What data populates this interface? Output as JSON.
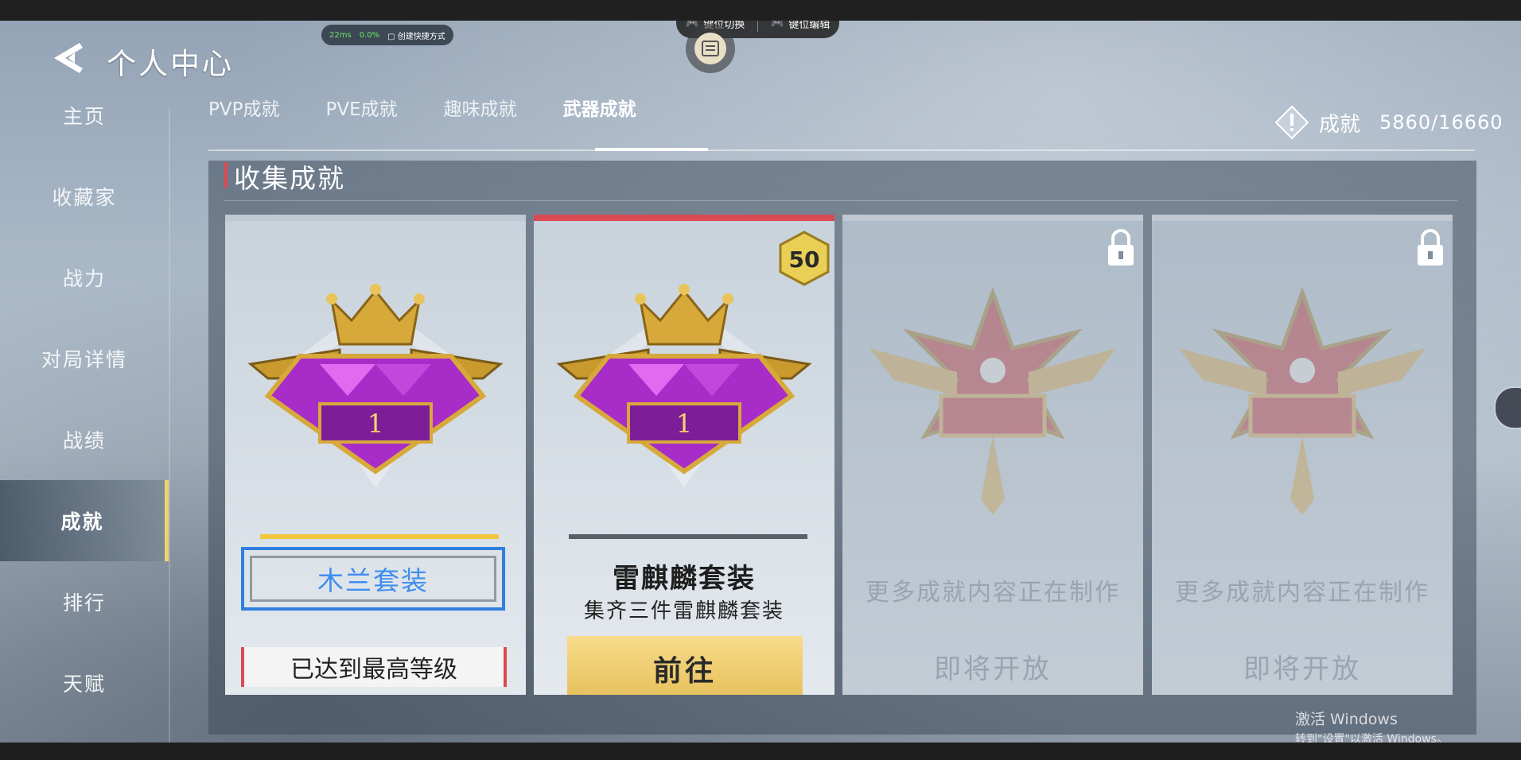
{
  "overlay": {
    "ping": "22ms",
    "loss": "0.0%",
    "shortcut": "创建快捷方式",
    "key_switch": "键位切换",
    "key_edit": "键位编辑"
  },
  "header": {
    "title": "个人中心"
  },
  "sidebar": {
    "items": [
      {
        "label": "主页"
      },
      {
        "label": "收藏家"
      },
      {
        "label": "战力"
      },
      {
        "label": "对局详情"
      },
      {
        "label": "战绩"
      },
      {
        "label": "成就"
      },
      {
        "label": "排行"
      },
      {
        "label": "天赋"
      }
    ],
    "active": "成就"
  },
  "tabs": [
    {
      "label": "PVP成就"
    },
    {
      "label": "PVE成就"
    },
    {
      "label": "趣味成就"
    },
    {
      "label": "武器成就"
    }
  ],
  "active_tab": "武器成就",
  "achievement_total": {
    "label": "成就",
    "value": "5860/16660"
  },
  "section": {
    "title": "收集成就"
  },
  "cards": [
    {
      "level": "1",
      "name": "木兰套装",
      "status": "已达到最高等级"
    },
    {
      "level": "1",
      "badge": "50",
      "name": "雷麒麟套装",
      "desc": "集齐三件雷麒麟套装",
      "button": "前往"
    },
    {
      "text": "更多成就内容正在制作",
      "soon": "即将开放"
    },
    {
      "text": "更多成就内容正在制作",
      "soon": "即将开放"
    }
  ],
  "colors": {
    "accent_gold": "#f2c63f",
    "selection_blue": "#2f7fe0",
    "red_marker": "#d94a52",
    "badge_gold": "#e9cf56"
  },
  "watermark": {
    "line1": "激活 Windows",
    "line2": "转到\"设置\"以激活 Windows。"
  }
}
